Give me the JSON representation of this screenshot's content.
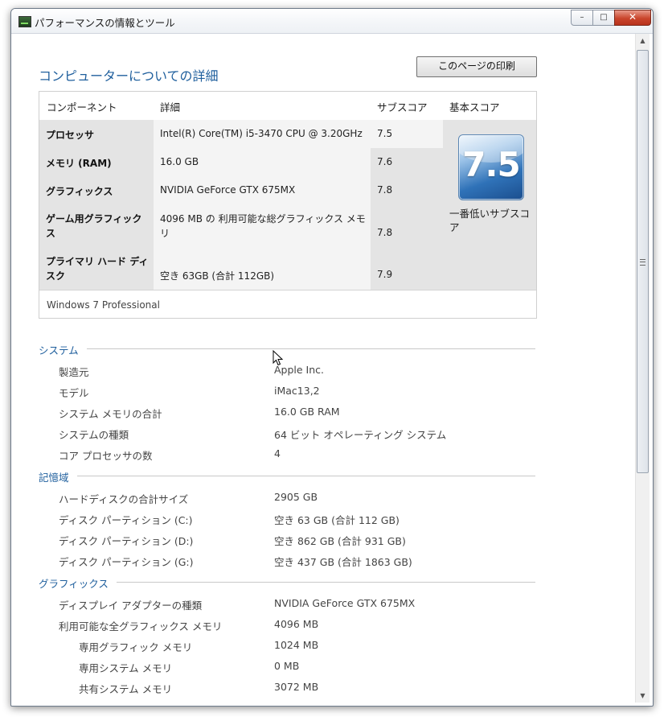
{
  "window": {
    "title": "パフォーマンスの情報とツール"
  },
  "page": {
    "title": "コンピューターについての詳細",
    "print_button": "このページの印刷"
  },
  "score_table": {
    "headers": {
      "component": "コンポーネント",
      "detail": "詳細",
      "subscore": "サブスコア",
      "basescore": "基本スコア"
    },
    "rows": [
      {
        "name": "プロセッサ",
        "detail": "Intel(R) Core(TM) i5-3470 CPU @ 3.20GHz",
        "score": "7.5"
      },
      {
        "name": "メモリ (RAM)",
        "detail": "16.0 GB",
        "score": "7.6"
      },
      {
        "name": "グラフィックス",
        "detail": "NVIDIA GeForce GTX 675MX",
        "score": "7.8"
      },
      {
        "name": "ゲーム用グラフィックス",
        "detail": "4096 MB の 利用可能な総グラフィックス メモリ",
        "score": "7.8"
      },
      {
        "name": "プライマリ ハード ディスク",
        "detail": "空き 63GB (合計 112GB)",
        "score": "7.9"
      }
    ],
    "base_score": "7.5",
    "base_score_label": "一番低いサブスコア",
    "os": "Windows 7 Professional"
  },
  "system": {
    "title": "システム",
    "items": [
      {
        "k": "製造元",
        "v": "Apple Inc."
      },
      {
        "k": "モデル",
        "v": "iMac13,2"
      },
      {
        "k": "システム メモリの合計",
        "v": "16.0 GB RAM"
      },
      {
        "k": "システムの種類",
        "v": "64 ビット オペレーティング システム"
      },
      {
        "k": "コア プロセッサの数",
        "v": "4"
      }
    ]
  },
  "storage": {
    "title": "記憶域",
    "items": [
      {
        "k": "ハードディスクの合計サイズ",
        "v": "2905 GB"
      },
      {
        "k": "ディスク パーティション (C:)",
        "v": "空き 63 GB (合計 112 GB)"
      },
      {
        "k": "ディスク パーティション (D:)",
        "v": "空き 862 GB (合計 931 GB)"
      },
      {
        "k": "ディスク パーティション (G:)",
        "v": "空き 437 GB (合計 1863 GB)"
      }
    ]
  },
  "graphics": {
    "title": "グラフィックス",
    "items": [
      {
        "k": "ディスプレイ アダプターの種類",
        "v": "NVIDIA GeForce GTX 675MX"
      },
      {
        "k": "利用可能な全グラフィックス メモリ",
        "v": "4096 MB"
      },
      {
        "k": "専用グラフィック メモリ",
        "v": "1024 MB"
      },
      {
        "k": "専用システム メモリ",
        "v": "0 MB"
      },
      {
        "k": "共有システム メモリ",
        "v": "3072 MB"
      }
    ]
  }
}
